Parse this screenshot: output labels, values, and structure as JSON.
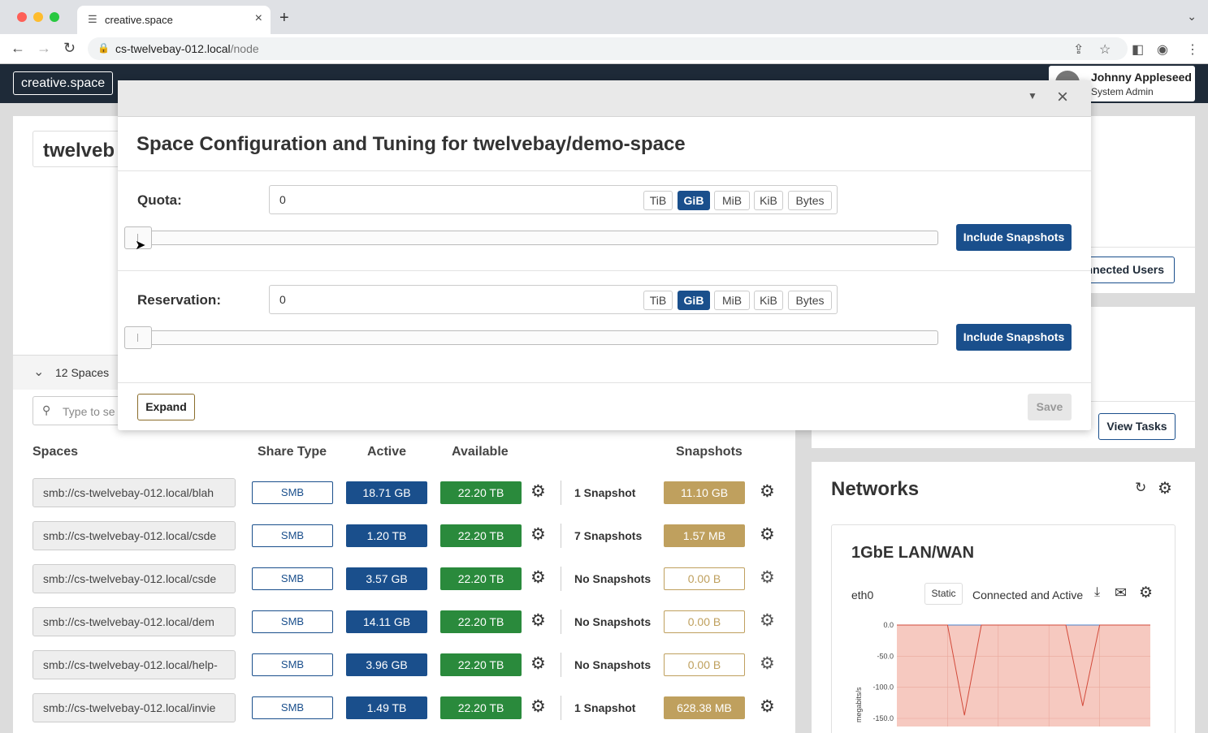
{
  "browser": {
    "tab_title": "creative.space",
    "url_host": "cs-twelvebay-012.local",
    "url_path": "/node"
  },
  "app": {
    "brand": "creative.space",
    "user_name": "Johnny Appleseed",
    "user_role": "System Admin"
  },
  "background": {
    "node_title": "twelveb",
    "spaces_count_label": "12 Spaces",
    "search_placeholder": "Type to se",
    "connected_users_button": "nnected Users",
    "view_tasks_button": "View Tasks",
    "columns": {
      "spaces": "Spaces",
      "share_type": "Share Type",
      "active": "Active",
      "available": "Available",
      "snapshots": "Snapshots"
    },
    "rows": [
      {
        "url": "smb://cs-twelvebay-012.local/blah",
        "share": "SMB",
        "active": "18.71 GB",
        "available": "22.20 TB",
        "snapshots": "1 Snapshot",
        "snap_size": "11.10 GB"
      },
      {
        "url": "smb://cs-twelvebay-012.local/csde",
        "share": "SMB",
        "active": "1.20 TB",
        "available": "22.20 TB",
        "snapshots": "7 Snapshots",
        "snap_size": "1.57 MB"
      },
      {
        "url": "smb://cs-twelvebay-012.local/csde",
        "share": "SMB",
        "active": "3.57 GB",
        "available": "22.20 TB",
        "snapshots": "No Snapshots",
        "snap_size": "0.00 B"
      },
      {
        "url": "smb://cs-twelvebay-012.local/dem",
        "share": "SMB",
        "active": "14.11 GB",
        "available": "22.20 TB",
        "snapshots": "No Snapshots",
        "snap_size": "0.00 B"
      },
      {
        "url": "smb://cs-twelvebay-012.local/help-",
        "share": "SMB",
        "active": "3.96 GB",
        "available": "22.20 TB",
        "snapshots": "No Snapshots",
        "snap_size": "0.00 B"
      },
      {
        "url": "smb://cs-twelvebay-012.local/invie",
        "share": "SMB",
        "active": "1.49 TB",
        "available": "22.20 TB",
        "snapshots": "1 Snapshot",
        "snap_size": "628.38 MB"
      }
    ]
  },
  "networks": {
    "title": "Networks",
    "card_title": "1GbE LAN/WAN",
    "interface": "eth0",
    "mode": "Static",
    "status": "Connected and Active",
    "chart_data": {
      "type": "area",
      "ylabel": "megabits/s",
      "yticks": [
        "0.0",
        "-50.0",
        "-100.0",
        "-150.0"
      ],
      "ylim": [
        -150,
        0
      ],
      "series": [
        {
          "values": [
            0,
            0,
            0,
            0,
            0,
            0,
            0,
            0,
            0,
            0,
            0,
            0,
            0,
            0,
            0,
            0
          ]
        },
        {
          "values": [
            0,
            0,
            0,
            0,
            -145,
            0,
            0,
            0,
            0,
            0,
            0,
            -130,
            0,
            0,
            0,
            0
          ]
        }
      ],
      "colors": {
        "fill": "#f6c9c0",
        "upload_line": "#4a7fc9",
        "download_line": "#d24a3a"
      }
    }
  },
  "modal": {
    "title": "Space Configuration and Tuning for twelvebay/demo-space",
    "quota_label": "Quota:",
    "quota_value": "0",
    "reservation_label": "Reservation:",
    "reservation_value": "0",
    "units": [
      "TiB",
      "GiB",
      "MiB",
      "KiB",
      "Bytes"
    ],
    "selected_unit": "GiB",
    "quota_slider_level": 0,
    "reservation_slider_level": 0,
    "include_snapshots": "Include Snapshots",
    "expand": "Expand",
    "save": "Save"
  },
  "colors": {
    "accent": "#1a4f8c",
    "available": "#2a8a3c",
    "snapshot": "#bfa05e",
    "appbar": "#1e2a38"
  }
}
